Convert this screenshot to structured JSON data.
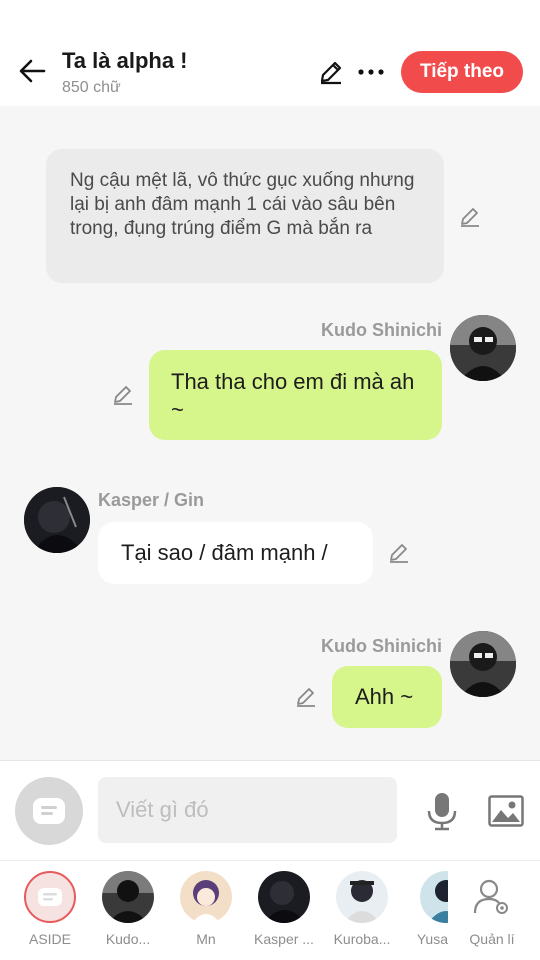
{
  "header": {
    "title": "Ta là alpha !",
    "word_count": "850 chữ",
    "next_label": "Tiếp theo"
  },
  "messages": {
    "narration": "Ng cậu mệt lã, vô thức gục xuống nhưng lại bị anh đâm mạnh 1 cái vào sâu bên trong, đụng trúng điểm G mà bắn ra",
    "m1": {
      "sender": "Kudo Shinichi",
      "text": "Tha tha cho em đi mà ah ~"
    },
    "m2": {
      "sender": "Kasper / Gin",
      "text": "Tại sao / đâm mạnh /"
    },
    "m3": {
      "sender": "Kudo Shinichi",
      "text": "Ahh ~"
    }
  },
  "composer": {
    "placeholder": "Viết gì đó"
  },
  "characters": [
    {
      "label": "ASIDE"
    },
    {
      "label": "Kudo..."
    },
    {
      "label": "Mn"
    },
    {
      "label": "Kasper ..."
    },
    {
      "label": "Kuroba..."
    },
    {
      "label": "Yusa"
    },
    {
      "label": "Quản lí"
    }
  ],
  "colors": {
    "accent": "#f24b4b",
    "bubble_green": "#d6f58a",
    "bubble_white": "#ffffff",
    "narration_bg": "#ebebeb"
  }
}
